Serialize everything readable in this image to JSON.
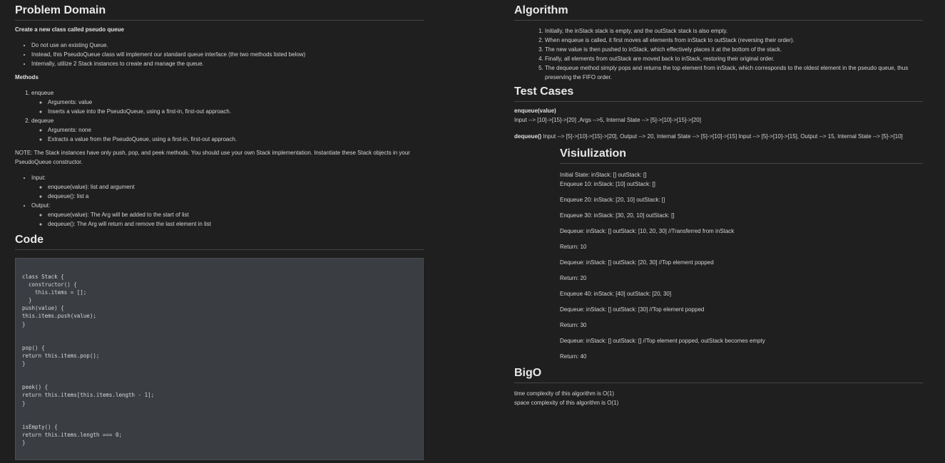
{
  "problem": {
    "heading": "Problem Domain",
    "intro": "Create a new class called pseudo queue",
    "bullets": [
      "Do not use an existing Queue.",
      "Instead, this PseudoQueue class will implement our standard queue interface (the two methods listed below)",
      "Internally, utilize 2 Stack instances to create and manage the queue."
    ],
    "methods_label": "Methods",
    "methods": [
      {
        "name": "enqueue",
        "details": [
          "Arguments: value",
          "Inserts a value into the PseudoQueue, using a first-in, first-out approach."
        ]
      },
      {
        "name": "dequeue",
        "details": [
          "Arguments: none",
          "Extracts a value from the PseudoQueue, using a first-in, first-out approach."
        ]
      }
    ],
    "note": "NOTE: The Stack instances have only push, pop, and peek methods. You should use your own Stack implementation. Instantiate these Stack objects in your PseudoQueue constructor.",
    "io": [
      {
        "label": "Input:",
        "items": [
          "enqueue(value): list and argument",
          "dequeue(): list a"
        ]
      },
      {
        "label": "Output:",
        "items": [
          "enqueue(value): The Arg will be added to the start of list",
          "dequeue(): The Arg will return and remove the last element in list"
        ]
      }
    ]
  },
  "code": {
    "heading": "Code",
    "text": "class Stack {\n  constructor() {\n    this.items = [];\n  }\npush(value) {\nthis.items.push(value);\n}\n\n\npop() {\nreturn this.items.pop();\n}\n\n\npeek() {\nreturn this.items[this.items.length - 1];\n}\n\n\nisEmpty() {\nreturn this.items.length === 0;\n}"
  },
  "algorithm": {
    "heading": "Algorithm",
    "steps": [
      "Initially, the inStack stack is empty, and the outStack stack is also empty.",
      "When enqueue is called, it first moves all elements from inStack to outStack (reversing their order).",
      "The new value is then pushed to inStack, which effectively places it at the bottom of the stack.",
      "Finally, all elements from outStack are moved back to inStack, restoring their original order.",
      "The dequeue method simply pops and returns the top element from inStack, which corresponds to the oldest element in the pseudo queue, thus preserving the FIFO order."
    ]
  },
  "tests": {
    "heading": "Test Cases",
    "enqueue_label": "enqueue(value)",
    "enqueue_text": "Input --> [10]->[15]->[20] ,Args -->5, Internal State --> [5]->[10]->[15]->[20]",
    "dequeue_label": "dequeue()",
    "dequeue_text": " Input --> [5]->[10]->[15]->[20], Output --> 20, Internal State --> [5]->[10]->[15] Input --> [5]->[10]->[15], Output --> 15, Internal State --> [5]->[10]"
  },
  "visualization": {
    "heading": "Visiulization",
    "initial": [
      "Initial State: inStack: [] outStack: []",
      "Enqueue 10: inStack: [10] outStack: []"
    ],
    "lines": [
      "Enqueue 20: inStack: [20, 10] outStack: []",
      "Enqueue 30: inStack: [30, 20, 10] outStack: []",
      "Dequeue: inStack: [] outStack: [10, 20, 30] //Transferred from inStack",
      "Return: 10",
      "Dequeue: inStack: [] outStack: [20, 30] //Top element popped",
      "Return: 20",
      "Enqueue 40: inStack: [40] outStack: [20, 30]",
      "Dequeue: inStack: [] outStack: [30] //Top element popped",
      "Return: 30",
      "Dequeue: inStack: [] outStack: [] //Top element popped, outStack becomes empty",
      "Return: 40"
    ]
  },
  "bigo": {
    "heading": "BigO",
    "time": "time complexity of this algorithm is O(1)",
    "space": "space complexity of this algorithm is O(1)"
  }
}
